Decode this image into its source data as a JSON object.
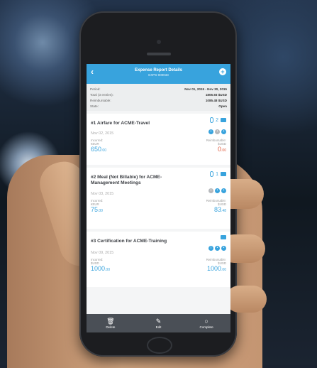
{
  "header": {
    "back": "‹",
    "title": "Expense Report Details",
    "subtitle": "EXPS-000033",
    "add": "+"
  },
  "summary": [
    {
      "label": "Period:",
      "value": "Nov 01, 2015 - Nov 30, 2015"
    },
    {
      "label": "Total (3 entries):",
      "value": "1806.93 $USD"
    },
    {
      "label": "Reimbursable:",
      "value": "1085.48 $USD"
    },
    {
      "label": "State:",
      "value": "Open"
    }
  ],
  "expenses": [
    {
      "title": "#1 Airfare for ACME-Travel",
      "attachments": "2",
      "date": "Nov 02, 2015",
      "incurred_label": "Incurred:",
      "incurred_currency": "€EUR",
      "incurred_amount": "650",
      "incurred_cents": ".00",
      "reimb_label": "Reimbursable:",
      "reimb_currency": "$USD",
      "reimb_amount": "0",
      "reimb_cents": ".00"
    },
    {
      "title": "#2 Meal (Not Billable) for ACME-Management Meetings",
      "attachments": "1",
      "date": "Nov 03, 2015",
      "incurred_label": "Incurred:",
      "incurred_currency": "€EUR",
      "incurred_amount": "75",
      "incurred_cents": ".00",
      "reimb_label": "Reimbursable:",
      "reimb_currency": "$USD",
      "reimb_amount": "83",
      "reimb_cents": ".48"
    },
    {
      "title": "#3 Certification for ACME-Training",
      "attachments": "",
      "date": "Nov 09, 2015",
      "incurred_label": "Incurred:",
      "incurred_currency": "$USD",
      "incurred_amount": "1000",
      "incurred_cents": ".00",
      "reimb_label": "Reimbursable:",
      "reimb_currency": "$USD",
      "reimb_amount": "1000",
      "reimb_cents": ".00"
    }
  ],
  "footer": {
    "delete": "Delete",
    "edit": "Edit",
    "complete": "Complete"
  },
  "colors": {
    "accent": "#38a3dd",
    "alert": "#e05a3b",
    "footer": "#4a4f56"
  }
}
